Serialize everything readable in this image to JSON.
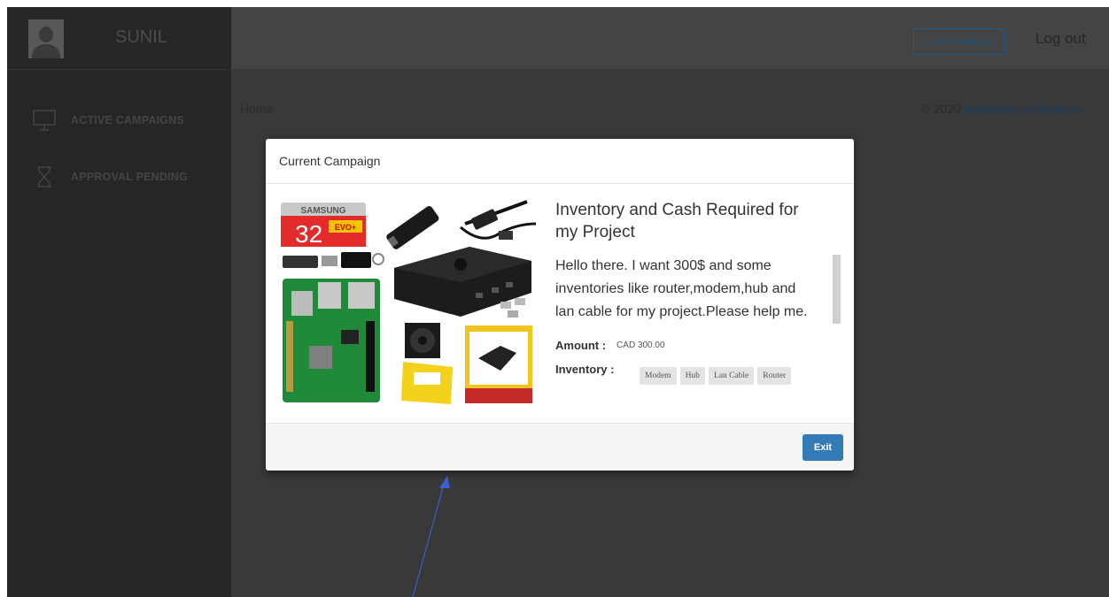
{
  "sidebar": {
    "username": "SUNIL",
    "items": [
      {
        "label": "ACTIVE CAMPAIGNS",
        "icon": "monitor-icon"
      },
      {
        "label": "APPROVAL PENDING",
        "icon": "hourglass-icon"
      }
    ]
  },
  "topbar": {
    "create_label": "Create Campaign",
    "logout_label": "Log out"
  },
  "content": {
    "breadcrumb": "Home",
    "copyright_prefix": "© 2020",
    "copyright_link": "University of Windsor"
  },
  "modal": {
    "title": "Current Campaign",
    "campaign_title": "Inventory and Cash Required for my Project",
    "description": "Hello there. I want 300$ and some inventories like router,modem,hub and lan cable for my project.Please help me.",
    "amount_label": "Amount :",
    "amount_value": "CAD 300.00",
    "inventory_label": "Inventory :",
    "inventory_items": [
      "Modem",
      "Hub",
      "Lan Cable",
      "Router"
    ],
    "exit_label": "Exit",
    "image_brand": "SAMSUNG",
    "image_card_size": "32",
    "image_card_line": "EVO+"
  },
  "colors": {
    "primary": "#337ab7",
    "sidebar_bg": "#262626",
    "overlay_content": "#393939",
    "annotation_arrow": "#3b5fcf"
  }
}
